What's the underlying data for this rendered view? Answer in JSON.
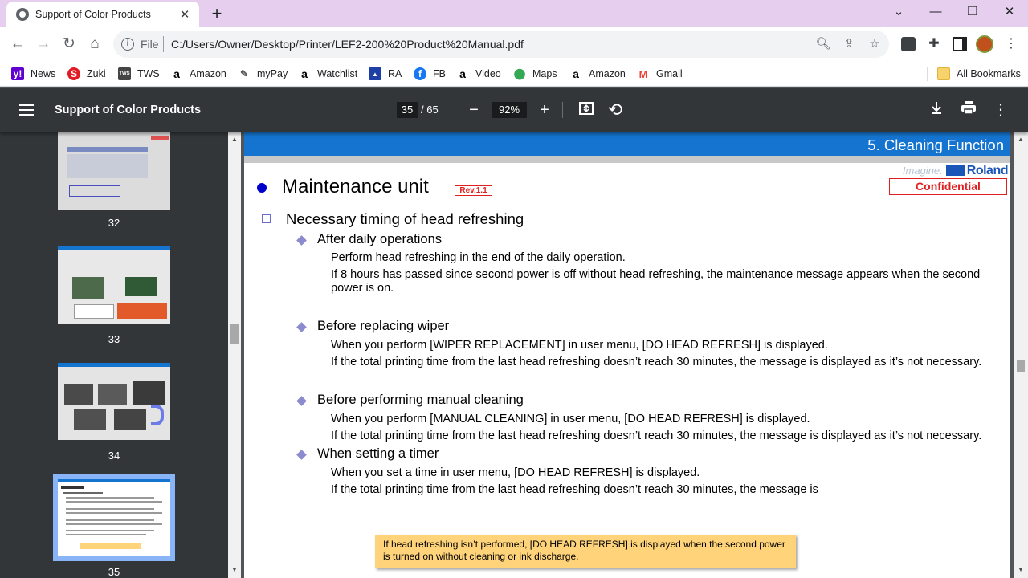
{
  "browser": {
    "tab_title": "Support of Color Products",
    "new_tab": "+",
    "url_scheme": "File",
    "url": "C:/Users/Owner/Desktop/Printer/LEF2-200%20Product%20Manual.pdf",
    "bookmarks": [
      {
        "label": "News",
        "icon": "yahoo-icon",
        "color": "#6001d2"
      },
      {
        "label": "Zuki",
        "icon": "zuki-icon",
        "color": "#e01b24"
      },
      {
        "label": "TWS",
        "icon": "tws-icon",
        "color": "#444444"
      },
      {
        "label": "Amazon",
        "icon": "amazon-icon",
        "color": "#000000"
      },
      {
        "label": "myPay",
        "icon": "mypay-icon",
        "color": "#555555"
      },
      {
        "label": "Watchlist",
        "icon": "amazon-icon",
        "color": "#000000"
      },
      {
        "label": "RA",
        "icon": "ra-icon",
        "color": "#1f3fa8"
      },
      {
        "label": "FB",
        "icon": "facebook-icon",
        "color": "#1877f2"
      },
      {
        "label": "Video",
        "icon": "amazon-icon",
        "color": "#000000"
      },
      {
        "label": "Maps",
        "icon": "maps-icon",
        "color": "#34a853"
      },
      {
        "label": "Amazon",
        "icon": "amazon-icon",
        "color": "#000000"
      },
      {
        "label": "Gmail",
        "icon": "gmail-icon",
        "color": "#ea4335"
      }
    ],
    "all_bookmarks": "All Bookmarks"
  },
  "viewer": {
    "title": "Support of Color Products",
    "page_current": "35",
    "page_total": "/ 65",
    "zoom": "92%",
    "thumbnails": [
      {
        "page": "32"
      },
      {
        "page": "33"
      },
      {
        "page": "34"
      },
      {
        "page": "35"
      }
    ]
  },
  "page": {
    "header_title": "5. Cleaning Function",
    "logo_imagine": "Imagine.",
    "logo_brand": "Roland",
    "confidential": "Confidential",
    "heading": "Maintenance unit",
    "rev": "Rev.1.1",
    "subheading": "Necessary timing of head refreshing",
    "sections": [
      {
        "title": "After daily operations",
        "lines": [
          "Perform head refreshing in the end of the daily operation.",
          "If 8 hours has passed since second power is off without head refreshing, the maintenance message appears when the second power is on."
        ]
      },
      {
        "title": "Before replacing wiper",
        "lines": [
          "When you perform [WIPER REPLACEMENT] in user menu, [DO HEAD REFRESH] is displayed.",
          "If the total printing time from the last head refreshing doesn’t reach 30 minutes, the message is displayed as it’s not necessary."
        ]
      },
      {
        "title": "Before performing manual cleaning",
        "lines": [
          "When you perform [MANUAL CLEANING] in user menu, [DO HEAD REFRESH] is displayed.",
          "If the total printing time from the last head refreshing doesn’t reach 30 minutes, the message is displayed as it’s not necessary."
        ]
      },
      {
        "title": "When setting a timer",
        "lines": [
          "When you set a time in user menu, [DO HEAD REFRESH] is displayed.",
          "If the total printing time from the last head refreshing doesn’t reach 30 minutes, the message is"
        ]
      }
    ],
    "note": "If head refreshing isn’t performed, [DO HEAD REFRESH] is displayed when the second power is turned on without cleaning or ink discharge."
  },
  "colors": {
    "tabstrip": "#e6cfee",
    "viewer_toolbar": "#323639",
    "header_blue": "#1574cf",
    "confidential_red": "#e02020",
    "note_bg": "#ffd37a"
  }
}
